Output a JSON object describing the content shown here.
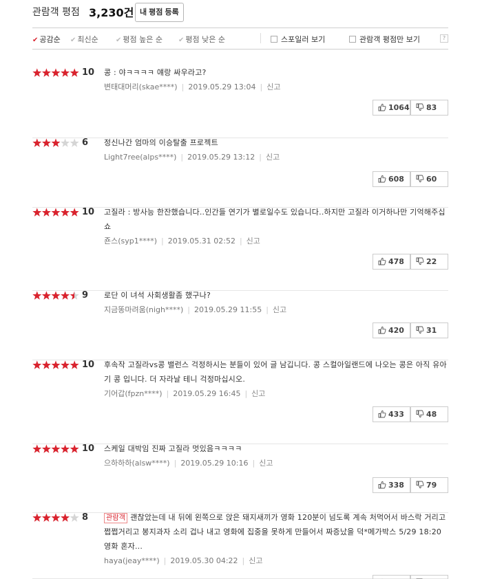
{
  "header": {
    "title": "관람객 평점",
    "count": "3,230건",
    "register_label": "내 평점 등록"
  },
  "sortbar": {
    "tabs": [
      {
        "label": "공감순",
        "active": true
      },
      {
        "label": "최신순",
        "active": false
      },
      {
        "label": "평점 높은 순",
        "active": false
      },
      {
        "label": "평점 낮은 순",
        "active": false
      }
    ],
    "spoiler_label": "스포일러 보기",
    "audience_only_label": "관람객 평점만 보기",
    "help": "?"
  },
  "colors": {
    "accent": "#d9232e",
    "star_on": "#d9232e",
    "star_off": "#d5d5d5"
  },
  "reviews": [
    {
      "rating": 10,
      "stars": 5,
      "badge": "",
      "text": "콩 : 야ㅋㅋㅋㅋ 얘랑 싸우라고?",
      "user": "변태대머리(skae****)",
      "date": "2019.05.29 13:04",
      "report": "신고",
      "up": "1064",
      "down": "83"
    },
    {
      "rating": 6,
      "stars": 3,
      "badge": "",
      "text": "정신나간 엄마의 이승탈출 프로젝트",
      "user": "Light7ree(alps****)",
      "date": "2019.05.29 13:12",
      "report": "신고",
      "up": "608",
      "down": "60"
    },
    {
      "rating": 10,
      "stars": 5,
      "badge": "",
      "text": "고질라 : 방사능 한잔했습니다..인간들 연기가 별로일수도 있습니다..하지만 고질라 이거하나만 기억해주십쇼",
      "user": "죤스(syp1****)",
      "date": "2019.05.31 02:52",
      "report": "신고",
      "up": "478",
      "down": "22"
    },
    {
      "rating": 9,
      "stars": 4.5,
      "badge": "",
      "text": "로단 이 녀석 사회생활좀 했구나?",
      "user": "지금똥마려움(nigh****)",
      "date": "2019.05.29 11:55",
      "report": "신고",
      "up": "420",
      "down": "31"
    },
    {
      "rating": 10,
      "stars": 5,
      "badge": "",
      "text": "후속작 고질라vs콩 밸런스 걱정하시는 분들이 있어 글 남깁니다. 콩 스컬아일랜드에 나오는 콩은 아직 유아기 콩 입니다. 더 자라날 테니 걱정마십시오.",
      "user": "기어갑(fpzn****)",
      "date": "2019.05.29 16:45",
      "report": "신고",
      "up": "433",
      "down": "48"
    },
    {
      "rating": 10,
      "stars": 5,
      "badge": "",
      "text": "스케일 대박임 진짜 고질라 멋있음ㅋㅋㅋㅋ",
      "user": "으하하하(alsw****)",
      "date": "2019.05.29 10:16",
      "report": "신고",
      "up": "338",
      "down": "79"
    },
    {
      "rating": 8,
      "stars": 4,
      "badge": "관람객",
      "text": "괜찮았는데 내 뒤에 왼쪽으로 앉은 돼지새끼가 영화 120분이 넘도록 계속 처먹어서 바스락 거리고 쩝쩝거리고 봉지과자 소리 겁나 내고 영화에 집중을 못하게 만들어서 짜증났을 덕*메가박스 5/29 18:20 영화 혼자...",
      "user": "haya(jeay****)",
      "date": "2019.05.30 04:22",
      "report": "신고",
      "up": "",
      "down": ""
    }
  ]
}
